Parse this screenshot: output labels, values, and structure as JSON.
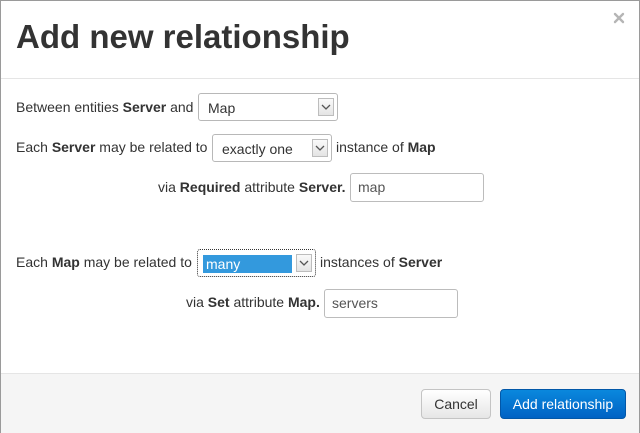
{
  "dialog": {
    "title": "Add new relationship",
    "close_symbol": "×"
  },
  "row1": {
    "prefix": "Between entities",
    "entity_a": "Server",
    "conjunction": "and",
    "entity_b_select": {
      "value": "Map"
    }
  },
  "row2": {
    "prefix": "Each",
    "entity": "Server",
    "middle": "may be related to",
    "cardinality_select": {
      "value": "exactly one"
    },
    "suffix": "instance of",
    "target": "Map"
  },
  "row3": {
    "prefix": "via",
    "attr_type": "Required",
    "middle": "attribute",
    "attr_owner": "Server.",
    "input_value": "map"
  },
  "row4": {
    "prefix": "Each",
    "entity": "Map",
    "middle": "may be related to",
    "cardinality_select": {
      "value": "many"
    },
    "suffix": "instances of",
    "target": "Server"
  },
  "row5": {
    "prefix": "via",
    "attr_type": "Set",
    "middle": "attribute",
    "attr_owner": "Map.",
    "input_value": "servers"
  },
  "footer": {
    "cancel_label": "Cancel",
    "submit_label": "Add relationship"
  },
  "colors": {
    "primary": "#0a6fd0",
    "selection": "#3399dd"
  },
  "icons": {
    "close": "close-icon",
    "dropdown": "chevron-down-icon"
  }
}
